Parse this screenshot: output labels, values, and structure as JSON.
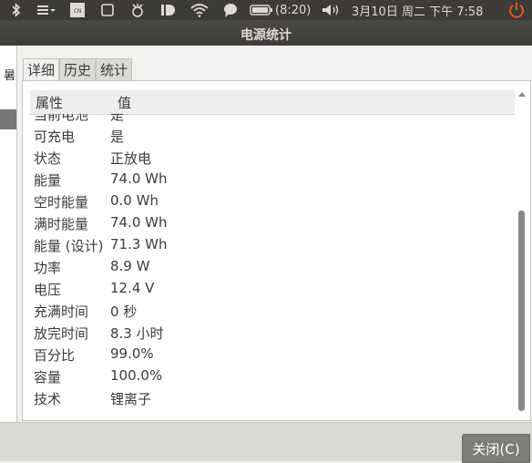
{
  "topbar": {
    "battery_time": "(8:20)",
    "datetime": "3月10日 周二 下午 7:58"
  },
  "window": {
    "title": "电源统计"
  },
  "left_panel": {
    "fragment": "暑"
  },
  "tabs": [
    {
      "label": "详细",
      "active": true
    },
    {
      "label": "历史",
      "active": false
    },
    {
      "label": "统计",
      "active": false
    }
  ],
  "list": {
    "headers": {
      "property": "属性",
      "value": "值"
    },
    "partial_row": {
      "property": "当前电池",
      "value": "是"
    },
    "rows": [
      {
        "property": "可充电",
        "value": "是"
      },
      {
        "property": "状态",
        "value": "正放电"
      },
      {
        "property": "能量",
        "value": "74.0 Wh"
      },
      {
        "property": "空时能量",
        "value": "0.0 Wh"
      },
      {
        "property": "满时能量",
        "value": "74.0 Wh"
      },
      {
        "property": "能量 (设计)",
        "value": "71.3 Wh"
      },
      {
        "property": "功率",
        "value": "8.9 W"
      },
      {
        "property": "电压",
        "value": "12.4 V"
      },
      {
        "property": "充满时间",
        "value": "0 秒"
      },
      {
        "property": "放完时间",
        "value": "8.3 小时"
      },
      {
        "property": "百分比",
        "value": "99.0%"
      },
      {
        "property": "容量",
        "value": "100.0%"
      },
      {
        "property": "技术",
        "value": "锂离子"
      }
    ]
  },
  "buttons": {
    "close": "关闭(C)"
  },
  "colors": {
    "topbar_bg": "#3c3b37",
    "power_icon": "#e95420"
  }
}
